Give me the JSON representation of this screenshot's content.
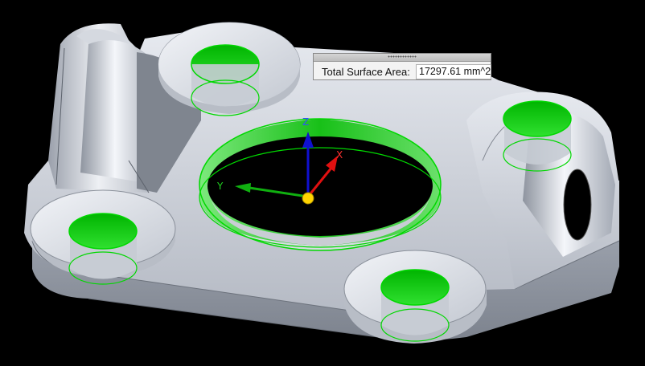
{
  "measure": {
    "label": "Total Surface Area:",
    "value": "17297.61 mm^2"
  },
  "triad": {
    "z_label": "Z",
    "x_label": "X",
    "y_label": "Y",
    "z_color": "#1010d0",
    "x_color": "#e01010",
    "y_color": "#10b010",
    "origin_color": "#ffd400"
  },
  "colors": {
    "background": "#000000",
    "selection_highlight": "#00c800",
    "part_body": "#c8ccd4"
  }
}
